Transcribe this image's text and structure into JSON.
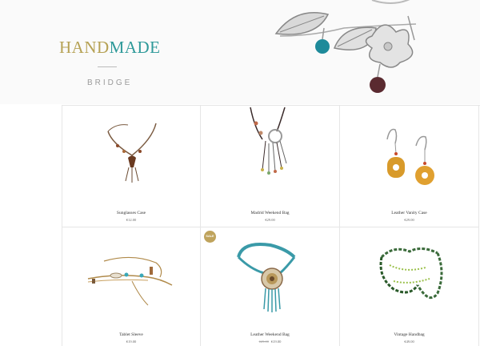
{
  "brand": {
    "part1": "HAND",
    "part2": "MADE",
    "subtitle": "BRIDGE"
  },
  "products": [
    {
      "name": "Sunglasses Case",
      "price": "€12.00",
      "icon": "necklace-brown-icon"
    },
    {
      "name": "Madrid Weekend Bag",
      "price": "€29.00",
      "icon": "necklace-tassel-icon"
    },
    {
      "name": "Leather Vanity Case",
      "price": "€29.00",
      "icon": "earrings-amber-icon"
    },
    {
      "name": "Tablet Sleeve",
      "price": "€19.00",
      "icon": "bracelet-cord-icon"
    },
    {
      "name": "Leather Weekend Bag",
      "price": "€19.00",
      "old_price": "€29.00",
      "badge": "SALE",
      "icon": "necklace-shell-icon"
    },
    {
      "name": "Vintage Handbag",
      "price": "€49.00",
      "icon": "necklace-green-beads-icon"
    }
  ],
  "colors": {
    "gold": "#b6a255",
    "teal": "#2f9a9a",
    "badge": "#bfa35c"
  }
}
